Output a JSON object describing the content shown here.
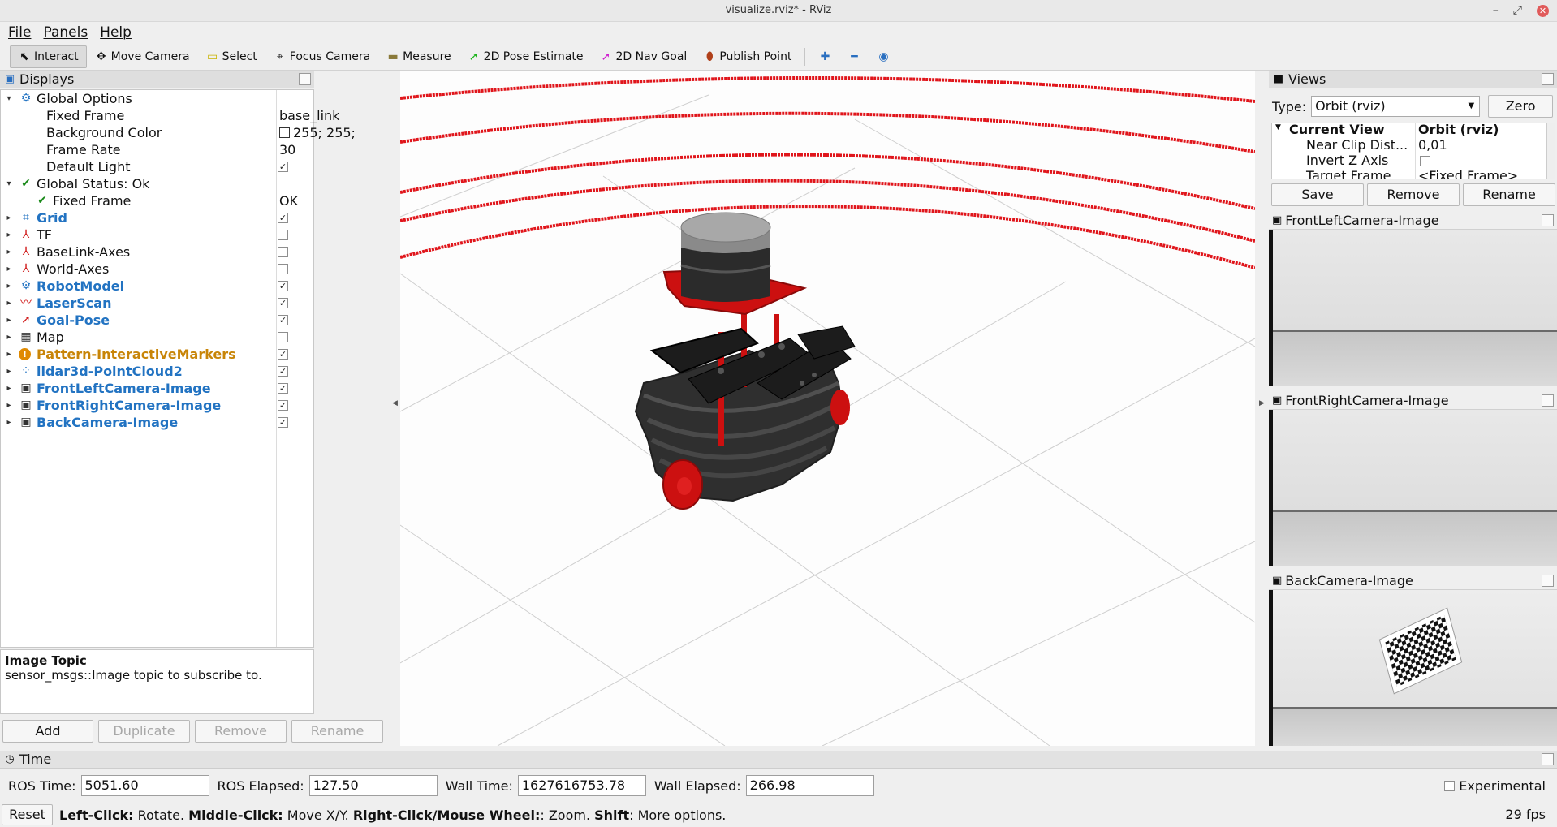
{
  "window": {
    "title": "visualize.rviz* - RViz"
  },
  "menu": [
    "File",
    "Panels",
    "Help"
  ],
  "toolbar": [
    {
      "label": "Interact",
      "icon": "cursor-icon",
      "glyph": "⬉",
      "active": true
    },
    {
      "label": "Move Camera",
      "icon": "move-camera-icon",
      "glyph": "✥"
    },
    {
      "label": "Select",
      "icon": "select-icon",
      "glyph": "▭"
    },
    {
      "label": "Focus Camera",
      "icon": "focus-camera-icon",
      "glyph": "⌖"
    },
    {
      "label": "Measure",
      "icon": "measure-icon",
      "glyph": "▬"
    },
    {
      "label": "2D Pose Estimate",
      "icon": "pose-estimate-icon",
      "glyph": "➚"
    },
    {
      "label": "2D Nav Goal",
      "icon": "nav-goal-icon",
      "glyph": "➚"
    },
    {
      "label": "Publish Point",
      "icon": "publish-point-icon",
      "glyph": "📍"
    }
  ],
  "displays": {
    "title": "Displays",
    "rows": [
      {
        "label": "Global Options",
        "value": "",
        "icon": "gear-icon",
        "glyph": "⚙",
        "indent": 0,
        "expand": "open",
        "style": "normal"
      },
      {
        "label": "Fixed Frame",
        "value": "base_link",
        "indent": 1,
        "expand": "",
        "style": "normal"
      },
      {
        "label": "Background Color",
        "value": "255; 255;",
        "swatch": true,
        "indent": 1,
        "expand": "",
        "style": "normal"
      },
      {
        "label": "Frame Rate",
        "value": "30",
        "indent": 1,
        "expand": "",
        "style": "normal"
      },
      {
        "label": "Default Light",
        "check": true,
        "indent": 1,
        "expand": "",
        "style": "normal"
      },
      {
        "label": "Global Status: Ok",
        "value": "",
        "icon": "ok-check-icon",
        "glyph": "✔",
        "indent": 0,
        "expand": "open",
        "style": "normal"
      },
      {
        "label": "Fixed Frame",
        "value": "OK",
        "icon": "ok-check-icon",
        "glyph": "✔",
        "indent": 1,
        "expand": "",
        "style": "normal"
      },
      {
        "label": "Grid",
        "check": true,
        "icon": "grid-icon",
        "glyph": "⌗",
        "indent": 0,
        "expand": "closed",
        "style": "blue"
      },
      {
        "label": "TF",
        "check": false,
        "icon": "tf-icon",
        "glyph": "⅄",
        "indent": 0,
        "expand": "closed",
        "style": "normal"
      },
      {
        "label": "BaseLink-Axes",
        "check": false,
        "icon": "axes-icon",
        "glyph": "⅄",
        "indent": 0,
        "expand": "closed",
        "style": "normal"
      },
      {
        "label": "World-Axes",
        "check": false,
        "icon": "axes-icon",
        "glyph": "⅄",
        "indent": 0,
        "expand": "closed",
        "style": "normal"
      },
      {
        "label": "RobotModel",
        "check": true,
        "icon": "robot-model-icon",
        "glyph": "⚙",
        "indent": 0,
        "expand": "closed",
        "style": "blue"
      },
      {
        "label": "LaserScan",
        "check": true,
        "icon": "laser-scan-icon",
        "glyph": "〰",
        "indent": 0,
        "expand": "closed",
        "style": "blue"
      },
      {
        "label": "Goal-Pose",
        "check": true,
        "icon": "pose-arrow-icon",
        "glyph": "➚",
        "indent": 0,
        "expand": "closed",
        "style": "blue"
      },
      {
        "label": "Map",
        "check": false,
        "icon": "map-icon",
        "glyph": "▦",
        "indent": 0,
        "expand": "closed",
        "style": "normal"
      },
      {
        "label": "Pattern-InteractiveMarkers",
        "check": true,
        "icon": "warning-icon",
        "glyph": "!",
        "indent": 0,
        "expand": "closed",
        "style": "orange"
      },
      {
        "label": "lidar3d-PointCloud2",
        "check": true,
        "icon": "point-cloud-icon",
        "glyph": "⁘",
        "indent": 0,
        "expand": "closed",
        "style": "blue"
      },
      {
        "label": "FrontLeftCamera-Image",
        "check": true,
        "icon": "image-icon",
        "glyph": "▣",
        "indent": 0,
        "expand": "closed",
        "style": "blue"
      },
      {
        "label": "FrontRightCamera-Image",
        "check": true,
        "icon": "image-icon",
        "glyph": "▣",
        "indent": 0,
        "expand": "closed",
        "style": "blue"
      },
      {
        "label": "BackCamera-Image",
        "check": true,
        "icon": "image-icon",
        "glyph": "▣",
        "indent": 0,
        "expand": "closed",
        "style": "blue"
      }
    ],
    "description": {
      "title": "Image Topic",
      "text": "sensor_msgs::Image topic to subscribe to."
    },
    "buttons": {
      "add": "Add",
      "duplicate": "Duplicate",
      "remove": "Remove",
      "rename": "Rename"
    }
  },
  "views": {
    "title": "Views",
    "type_label": "Type:",
    "type_value": "Orbit (rviz)",
    "zero": "Zero",
    "current": {
      "label": "Current View",
      "value": "Orbit (rviz)"
    },
    "props": [
      {
        "label": "Near Clip Dist...",
        "value": "0,01"
      },
      {
        "label": "Invert Z Axis",
        "value": ""
      },
      {
        "label": "Target Frame",
        "value": "<Fixed Frame>"
      }
    ],
    "buttons": {
      "save": "Save",
      "remove": "Remove",
      "rename": "Rename"
    }
  },
  "cameras": [
    "FrontLeftCamera-Image",
    "FrontRightCamera-Image",
    "BackCamera-Image"
  ],
  "time": {
    "title": "Time",
    "ros_time_label": "ROS Time:",
    "ros_time": "5051.60",
    "ros_elapsed_label": "ROS Elapsed:",
    "ros_elapsed": "127.50",
    "wall_time_label": "Wall Time:",
    "wall_time": "1627616753.78",
    "wall_elapsed_label": "Wall Elapsed:",
    "wall_elapsed": "266.98",
    "experimental": "Experimental"
  },
  "status": {
    "reset": "Reset",
    "hints": [
      {
        "key": "Left-Click:",
        "text": " Rotate. "
      },
      {
        "key": "Middle-Click:",
        "text": " Move X/Y. "
      },
      {
        "key": "Right-Click/Mouse Wheel:",
        "text": ": Zoom. "
      },
      {
        "key": "Shift",
        "text": ": More options."
      }
    ],
    "fps": "29 fps"
  },
  "colors": {
    "laser": "#e0151b",
    "robot_red": "#cc1010",
    "robot_body": "#3a3a3a",
    "display_blue": "#2273c2"
  }
}
